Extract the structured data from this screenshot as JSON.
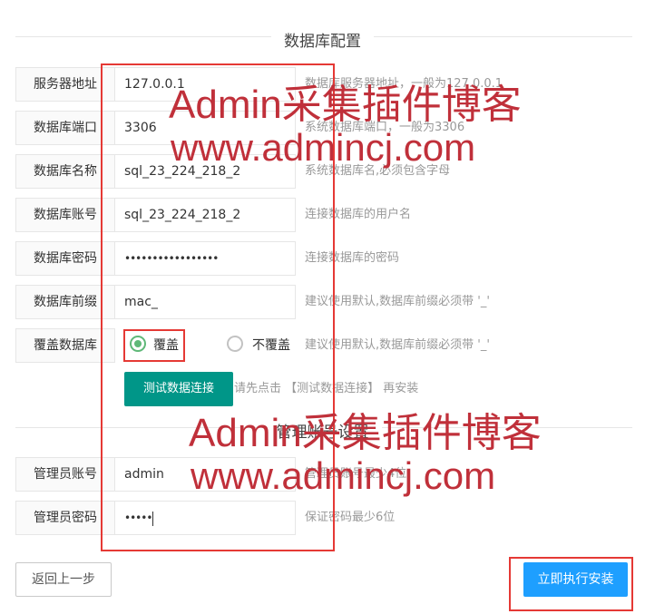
{
  "db_section": {
    "title": "数据库配置"
  },
  "fields": [
    {
      "label": "服务器地址",
      "value": "127.0.0.1",
      "hint": "数据库服务器地址，一般为127.0.0.1"
    },
    {
      "label": "数据库端口",
      "value": "3306",
      "hint": "系统数据库端口，一般为3306"
    },
    {
      "label": "数据库名称",
      "value": "sql_23_224_218_2",
      "hint": "系统数据库名,必须包含字母"
    },
    {
      "label": "数据库账号",
      "value": "sql_23_224_218_2",
      "hint": "连接数据库的用户名"
    },
    {
      "label": "数据库密码",
      "value": "•••••••••••••••••",
      "hint": "连接数据库的密码"
    },
    {
      "label": "数据库前缀",
      "value": "mac_",
      "hint": "建议使用默认,数据库前缀必须带 '_'"
    }
  ],
  "overwrite": {
    "label": "覆盖数据库",
    "option_yes": "覆盖",
    "option_no": "不覆盖",
    "selected": "覆盖",
    "hint": "建议使用默认,数据库前缀必须带 '_'"
  },
  "test_button": {
    "label": "测试数据连接",
    "hint": "请先点击 【测试数据连接】 再安装"
  },
  "admin_section": {
    "title": "管理账号设置"
  },
  "admin_fields": [
    {
      "label": "管理员账号",
      "value": "admin",
      "hint": "管理员账号最少4位"
    },
    {
      "label": "管理员密码",
      "value": "•••••",
      "hint": "保证密码最少6位"
    }
  ],
  "actions": {
    "back_label": "返回上一步",
    "install_label": "立即执行安装"
  },
  "watermark": {
    "line1": "Admin采集插件博客",
    "line2": "www.admincj.com"
  },
  "colors": {
    "primary_green": "#009688",
    "install_blue": "#1E9FFF",
    "radio_green": "#5FB878",
    "highlight_red": "#e53935"
  }
}
